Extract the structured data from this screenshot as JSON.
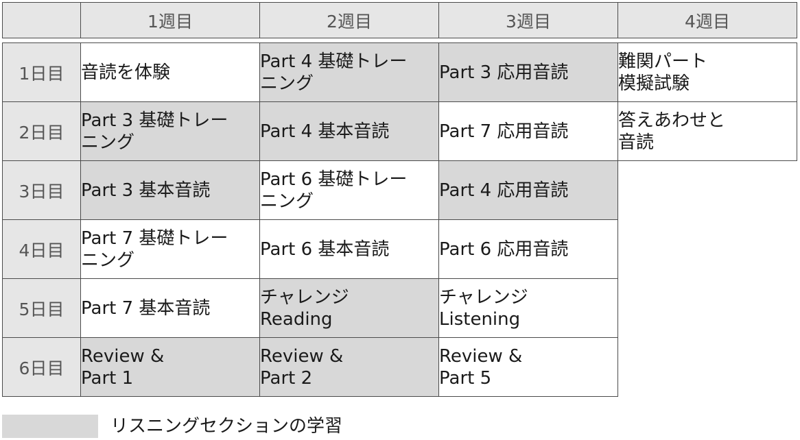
{
  "weeks": [
    "1週目",
    "2週目",
    "3週目",
    "4週目"
  ],
  "rows": [
    {
      "day": "1日目",
      "w1": "音読を体験",
      "w2_l1": "Part 4 基礎トレー",
      "w2_l2": "ニング",
      "w3": "Part 3 応用音読",
      "w4_l1": "難関パート",
      "w4_l2": "模擬試験"
    },
    {
      "day": "2日目",
      "w1_l1": "Part 3 基礎トレー",
      "w1_l2": "ニング",
      "w2": "Part 4 基本音読",
      "w3": "Part 7 応用音読",
      "w4_l1": "答えあわせと",
      "w4_l2": "音読"
    },
    {
      "day": "3日目",
      "w1": "Part 3 基本音読",
      "w2_l1": "Part 6 基礎トレー",
      "w2_l2": "ニング",
      "w3": "Part 4 応用音読"
    },
    {
      "day": "4日目",
      "w1_l1": "Part 7 基礎トレー",
      "w1_l2": "ニング",
      "w2": "Part 6 基本音読",
      "w3": "Part 6 応用音読"
    },
    {
      "day": "5日目",
      "w1": "Part 7 基本音読",
      "w2_l1": "チャレンジ",
      "w2_l2": "Reading",
      "w3_l1": "チャレンジ",
      "w3_l2": "Listening"
    },
    {
      "day": "6日目",
      "w1_l1": "Review &",
      "w1_l2": "Part 1",
      "w2_l1": "Review &",
      "w2_l2": "Part 2",
      "w3_l1": "Review &",
      "w3_l2": "Part 5"
    }
  ],
  "legend": {
    "label": "リスニングセクションの学習",
    "swatch_color": "#d8d8d8"
  },
  "colors": {
    "listening_fill": "#d8d8d8",
    "header_fill": "#e6e6e6",
    "border": "#4a4a4a"
  }
}
